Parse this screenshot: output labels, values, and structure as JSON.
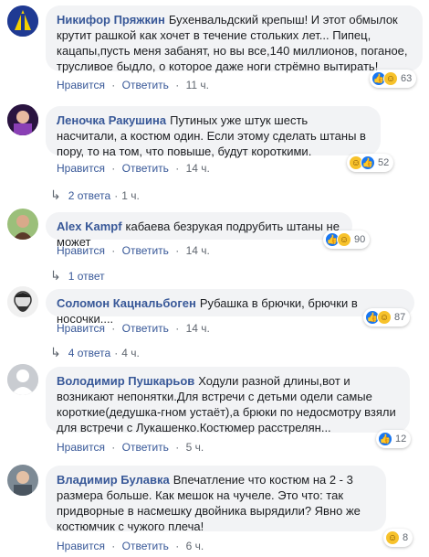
{
  "colors": {
    "author": "#385898",
    "bubble": "#f2f3f5",
    "like": "#1877f2",
    "haha": "#f7c22b"
  },
  "comments": [
    {
      "author": "Никифор Пряжкин",
      "text": "Бухенвальдский крепыш! И этот обмылок крутит рашкой как хочет в течение стольких лет... Пипец, кацапы,пусть меня забанят, но вы все,140 миллионов, поганое, трусливое быдло, о которое даже ноги стрёмно вытирать!",
      "like": "Нравится",
      "reply": "Ответить",
      "time": "11 ч.",
      "reactions": [
        "like-icon",
        "haha-icon"
      ],
      "count": "63"
    },
    {
      "author": "Леночка Ракушина",
      "text": "Путиных уже штук шесть насчитали, а костюм один. Если этому сделать штаны в пору, то на том, что повыше, будут короткими.",
      "like": "Нравится",
      "reply": "Ответить",
      "time": "14 ч.",
      "reactions": [
        "haha-icon",
        "like-icon"
      ],
      "count": "52",
      "replies": "2 ответа",
      "replies_time": "1 ч."
    },
    {
      "author": "Alex Kampf",
      "text": "кабаева безрукая подрубить штаны не может",
      "like": "Нравится",
      "reply": "Ответить",
      "time": "14 ч.",
      "reactions": [
        "like-icon",
        "haha-icon"
      ],
      "count": "90",
      "replies": "1 ответ",
      "replies_time": ""
    },
    {
      "author": "Соломон Кацнальбоген",
      "text": "Рубашка в брючки, брючки в носочки....",
      "like": "Нравится",
      "reply": "Ответить",
      "time": "14 ч.",
      "reactions": [
        "like-icon",
        "haha-icon"
      ],
      "count": "87",
      "replies": "4 ответа",
      "replies_time": "4 ч."
    },
    {
      "author": "Володимир Пушкарьов",
      "text": "Ходули разной длины,вот и возникают непонятки.Для встречи с детьми одели самые короткие(дедушка-гном устаёт),а брюки по недосмотру взяли для встречи с Лукашенко.Костюмер расстрелян...",
      "like": "Нравится",
      "reply": "Ответить",
      "time": "5 ч.",
      "reactions": [
        "like-icon"
      ],
      "count": "12"
    },
    {
      "author": "Владимир Булавка",
      "text": "Впечатление что костюм на 2 - 3 размера больше. Как мешок на чучеле. Это что: так придворные в насмешку двойника вырядили? Явно же костюмчик с чужого плеча!",
      "like": "Нравится",
      "reply": "Ответить",
      "time": "6 ч.",
      "reactions": [
        "haha-icon"
      ],
      "count": "8"
    }
  ]
}
